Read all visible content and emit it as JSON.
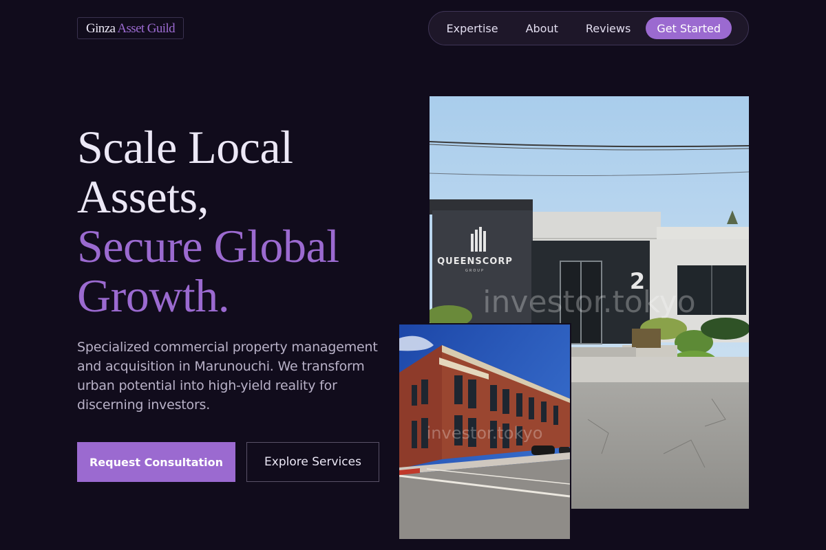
{
  "brand": {
    "name_part1": "Ginza",
    "name_part2": "Asset Guild"
  },
  "nav": {
    "links": [
      "Expertise",
      "About",
      "Reviews"
    ],
    "cta": "Get Started"
  },
  "hero": {
    "title_line1": "Scale Local",
    "title_line2": "Assets,",
    "title_line3": "Secure Global",
    "title_line4": "Growth.",
    "description": "Specialized commercial property management and acquisition in Marunouchi. We transform urban potential into high-yield reality for discerning investors.",
    "primary_button": "Request Consultation",
    "secondary_button": "Explore Services"
  },
  "images": {
    "large": {
      "sign_title": "QUEENSCORP",
      "sign_subtitle": "GROUP",
      "building_number": "2",
      "watermark": "investor.tokyo"
    },
    "small": {
      "watermark": "investor.tokyo"
    }
  },
  "colors": {
    "background": "#110c1c",
    "accent": "#9b6ad0",
    "text": "#ece8f6",
    "muted_text": "#b9b2c8"
  }
}
